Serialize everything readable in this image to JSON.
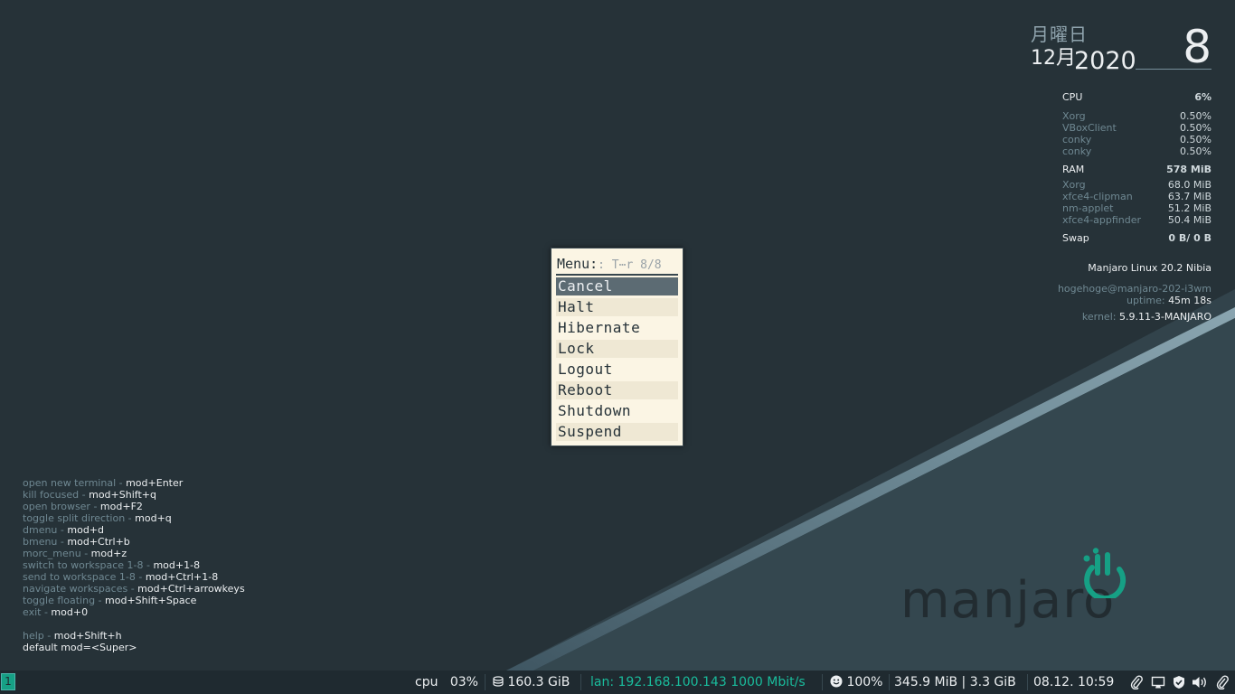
{
  "clock": {
    "weekday": "月曜日",
    "month": "12月",
    "year": "2020",
    "day": "8"
  },
  "stats": {
    "cpu": {
      "label": "CPU",
      "value": "6%",
      "procs": [
        {
          "name": "Xorg",
          "value": "0.50%"
        },
        {
          "name": "VBoxClient",
          "value": "0.50%"
        },
        {
          "name": "conky",
          "value": "0.50%"
        },
        {
          "name": "conky",
          "value": "0.50%"
        }
      ]
    },
    "ram": {
      "label": "RAM",
      "value": "578 MiB",
      "procs": [
        {
          "name": "Xorg",
          "value": "68.0 MiB"
        },
        {
          "name": "xfce4-clipman",
          "value": "63.7 MiB"
        },
        {
          "name": "nm-applet",
          "value": "51.2 MiB"
        },
        {
          "name": "xfce4-appfinder",
          "value": "50.4 MiB"
        }
      ]
    },
    "swap": {
      "label": "Swap",
      "value": "0 B/ 0 B"
    }
  },
  "system": {
    "distro": "Manjaro Linux 20.2 Nibia",
    "user_host": "hogehoge@manjaro-202-i3wm",
    "uptime_label": "uptime:",
    "uptime_value": "45m 18s",
    "kernel_label": "kernel:",
    "kernel_value": "5.9.11-3-MANJARO"
  },
  "help": [
    {
      "desc": "open new terminal - ",
      "keys": "mod+Enter"
    },
    {
      "desc": "kill focused - ",
      "keys": "mod+Shift+q"
    },
    {
      "desc": "open browser - ",
      "keys": "mod+F2"
    },
    {
      "desc": "toggle split direction - ",
      "keys": "mod+q"
    },
    {
      "desc": "dmenu - ",
      "keys": "mod+d"
    },
    {
      "desc": "bmenu - ",
      "keys": "mod+Ctrl+b"
    },
    {
      "desc": "morc_menu - ",
      "keys": "mod+z"
    },
    {
      "desc": "switch to workspace 1-8 - ",
      "keys": "mod+1-8"
    },
    {
      "desc": "send to workspace 1-8 - ",
      "keys": "mod+Ctrl+1-8"
    },
    {
      "desc": "navigate workspaces - ",
      "keys": "mod+Ctrl+arrowkeys"
    },
    {
      "desc": "toggle floating - ",
      "keys": "mod+Shift+Space"
    },
    {
      "desc": "exit - ",
      "keys": "mod+0"
    }
  ],
  "help_footer": {
    "help_desc": "help - ",
    "help_keys": "mod+Shift+h",
    "default_mod": "default mod=<Super>"
  },
  "logo": {
    "text": "manjaro"
  },
  "menu": {
    "prompt": "Menu:",
    "filter": ": T⋯r 8/8",
    "items": [
      "Cancel",
      "Halt",
      "Hibernate",
      "Lock",
      "Logout",
      "Reboot",
      "Shutdown",
      "Suspend"
    ],
    "selected": "Cancel"
  },
  "bar": {
    "workspace": "1",
    "cpu_label": "cpu",
    "cpu_value": "03%",
    "disk": "160.3 GiB",
    "lan": "lan: 192.168.100.143 1000 Mbit/s",
    "battery": "100%",
    "memory": "345.9 MiB | 3.3 GiB",
    "datetime": "08.12. 10:59"
  },
  "colors": {
    "background": "#263238",
    "accent": "#1abc9c",
    "menu_bg": "#fbf5e4",
    "menu_selected": "#5c6b73"
  },
  "tray_icons": [
    "paperclip-icon",
    "display-icon",
    "shield-icon",
    "volume-icon",
    "clipboard-icon"
  ]
}
